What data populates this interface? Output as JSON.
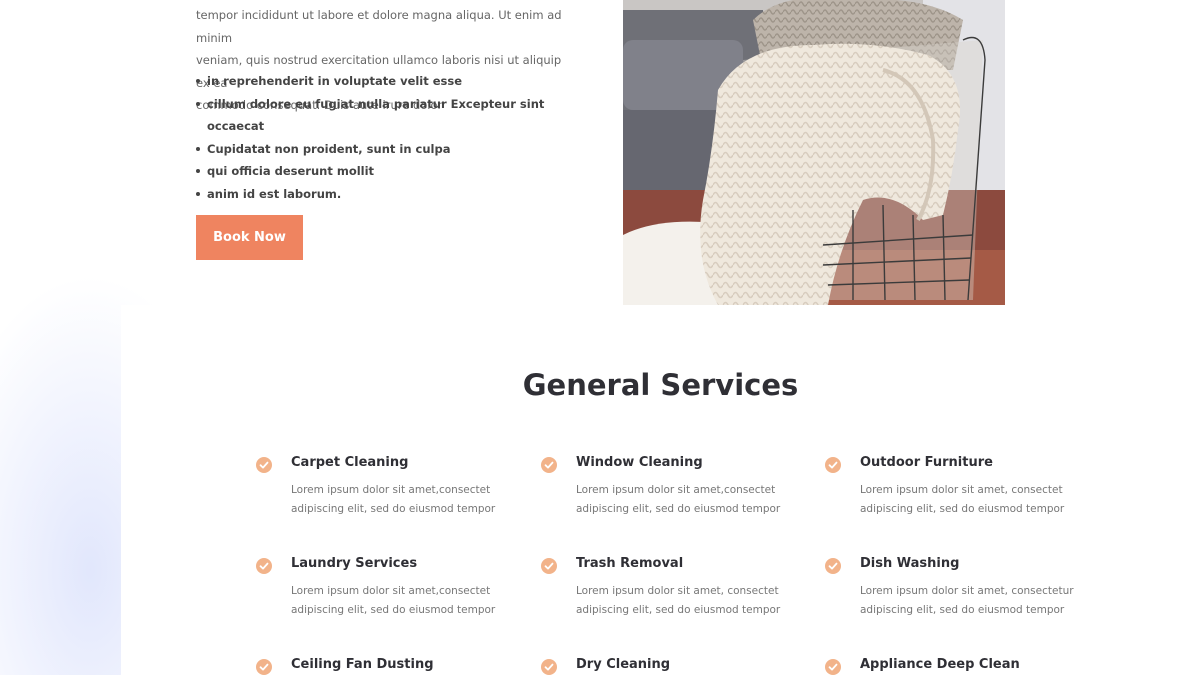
{
  "intro": {
    "paragraph_lines": [
      "tempor incididunt ut labore et dolore magna aliqua. Ut enim ad minim",
      "veniam, quis nostrud exercitation ullamco laboris nisi ut aliquip ex ea",
      "commodo consequat. Duis aute irure dolor"
    ],
    "bullets": [
      "in reprehenderit in voluptate velit esse",
      "cillum dolore eu fugiat nulla pariatur Excepteur sint occaecat",
      "Cupidatat non proident, sunt in culpa",
      "qui officia deserunt mollit",
      "anim id est laborum."
    ],
    "book_button": "Book Now"
  },
  "services": {
    "title": "General Services",
    "items": [
      {
        "name": "Carpet Cleaning",
        "desc1": "Lorem ipsum dolor sit amet,consectet",
        "desc2": "adipiscing elit, sed do eiusmod tempor"
      },
      {
        "name": "Window Cleaning",
        "desc1": "Lorem ipsum dolor sit amet,consectet",
        "desc2": "adipiscing elit, sed do eiusmod tempor"
      },
      {
        "name": "Outdoor Furniture",
        "desc1": "Lorem ipsum dolor sit amet, consectet",
        "desc2": "adipiscing elit, sed do eiusmod tempor"
      },
      {
        "name": "Laundry Services",
        "desc1": "Lorem ipsum dolor sit amet,consectet",
        "desc2": "adipiscing elit, sed do eiusmod tempor"
      },
      {
        "name": "Trash Removal",
        "desc1": "Lorem ipsum dolor sit amet, consectet",
        "desc2": "adipiscing elit, sed do eiusmod tempor"
      },
      {
        "name": "Dish Washing",
        "desc1": "Lorem ipsum dolor sit amet, consectetur",
        "desc2": "adipiscing elit, sed do eiusmod tempor"
      },
      {
        "name": "Ceiling Fan Dusting",
        "desc1": "",
        "desc2": ""
      },
      {
        "name": "Dry Cleaning",
        "desc1": "",
        "desc2": ""
      },
      {
        "name": "Appliance Deep Clean",
        "desc1": "",
        "desc2": ""
      }
    ]
  },
  "colors": {
    "accent": "#ef8460",
    "check": "#f2b38a",
    "heading": "#2f2f35"
  },
  "icons": {
    "check": "check-circle-icon"
  }
}
